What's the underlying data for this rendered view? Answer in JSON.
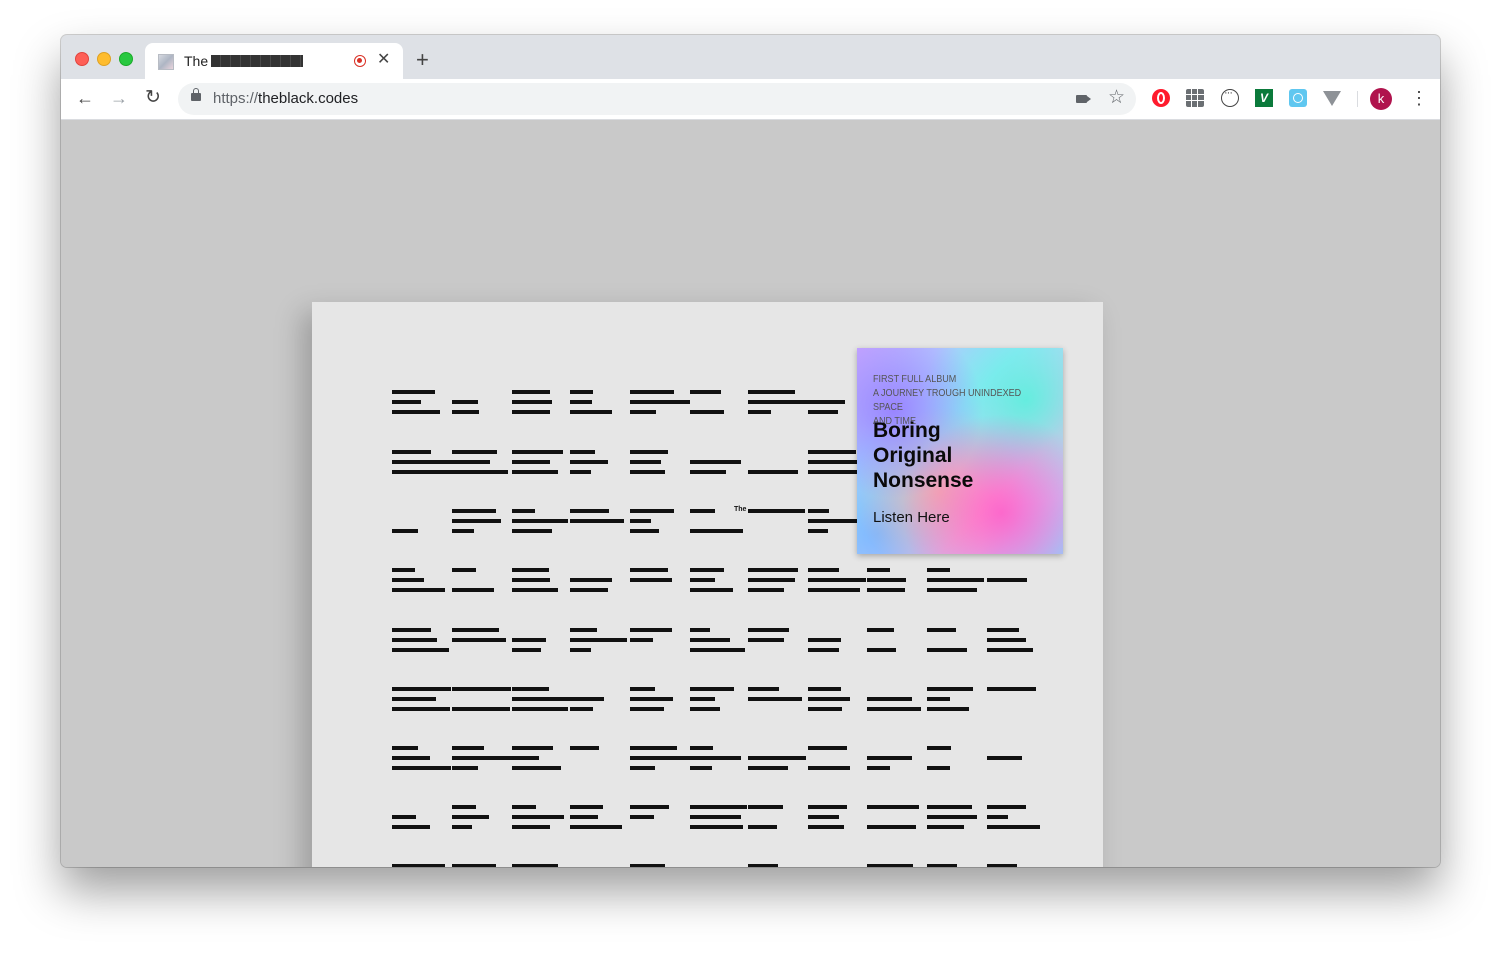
{
  "browser": {
    "tab": {
      "title": "The",
      "favicon": "page-favicon-icon"
    },
    "address_bar": {
      "scheme": "https://",
      "host": "theblack.codes"
    },
    "profile_initial": "k",
    "icons": {
      "back": "back-arrow-icon",
      "forward": "forward-arrow-icon",
      "reload": "reload-icon",
      "lock": "lock-icon",
      "camera": "camera-icon",
      "bookmark": "star-icon",
      "menu": "vertical-dots-icon"
    },
    "extensions": [
      "opera-icon",
      "grid-icon",
      "ring-icon",
      "v-icon",
      "camera-ext-icon",
      "vee-icon"
    ]
  },
  "page": {
    "background": "#c9c9c9",
    "paper_title": "The",
    "album": {
      "subtitle_lines": [
        "FIRST FULL ALBUM",
        "A JOURNEY TROUGH UNINDEXED SPACE",
        "AND TIME"
      ],
      "title_lines": [
        "Boring",
        "Original",
        "Nonsense"
      ],
      "link": "Listen Here"
    }
  },
  "colors": {
    "profile": "#b0134d",
    "record": "#d93025"
  }
}
